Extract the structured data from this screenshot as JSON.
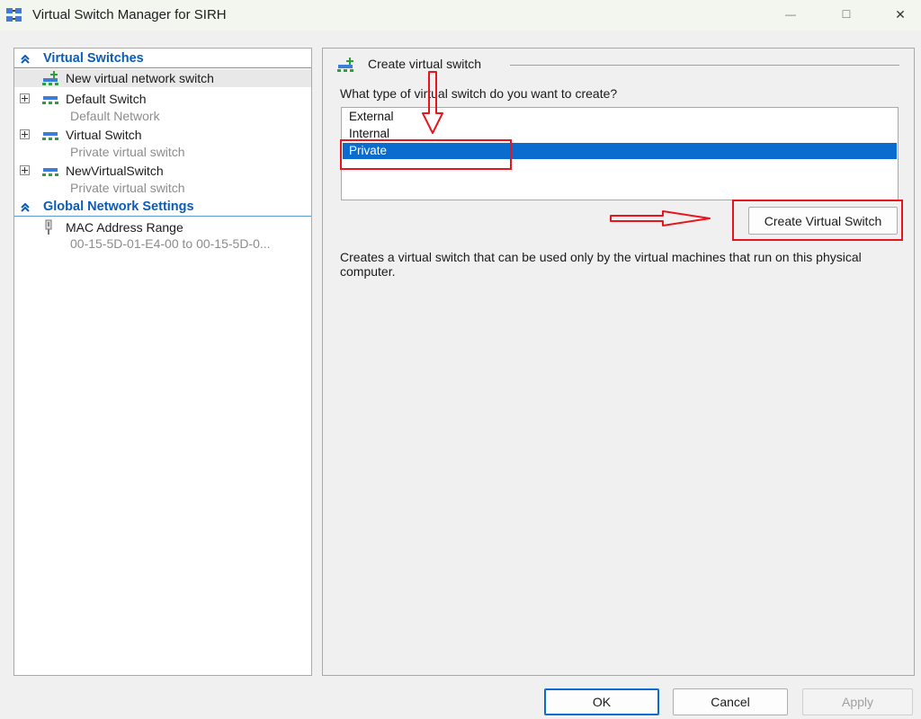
{
  "window": {
    "title": "Virtual Switch Manager for SIRH",
    "minimize_glyph": "—",
    "maximize_glyph": "☐",
    "close_glyph": "✕"
  },
  "tree": {
    "section_virtual_switches": "Virtual Switches",
    "new_switch": "New virtual network switch",
    "switches": [
      {
        "name": "Default Switch",
        "subtitle": "Default Network"
      },
      {
        "name": "Virtual Switch",
        "subtitle": "Private virtual switch"
      },
      {
        "name": "NewVirtualSwitch",
        "subtitle": "Private virtual switch"
      }
    ],
    "section_global": "Global Network Settings",
    "mac": {
      "name": "MAC Address Range",
      "subtitle": "00-15-5D-01-E4-00 to 00-15-5D-0..."
    }
  },
  "create": {
    "title": "Create virtual switch",
    "question": "What type of virtual switch do you want to create?",
    "types": [
      "External",
      "Internal",
      "Private"
    ],
    "selected": "Private",
    "button": "Create Virtual Switch",
    "description": "Creates a virtual switch that can be used only by the virtual machines that run on this physical computer."
  },
  "footer": {
    "ok": "OK",
    "cancel": "Cancel",
    "apply": "Apply"
  },
  "colors": {
    "selection": "#0a6ccf",
    "section_header": "#0b5cb8",
    "annotation": "#e8141e"
  }
}
